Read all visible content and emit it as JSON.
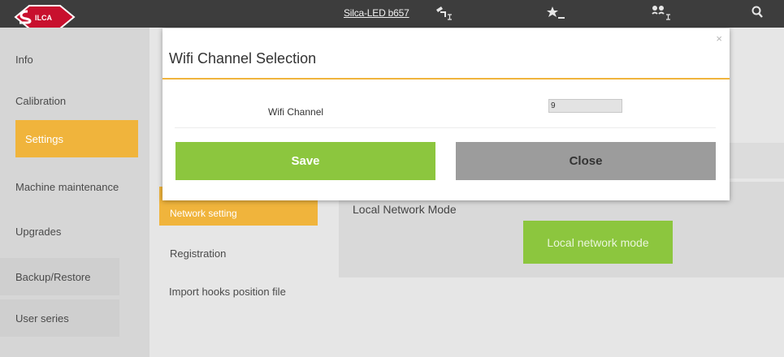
{
  "topbar": {
    "device_name": "Silca-LED b657",
    "icons": [
      "machine-icon",
      "star-icon",
      "users-icon",
      "search-icon"
    ]
  },
  "sidebar": {
    "items": [
      {
        "label": "Info"
      },
      {
        "label": "Calibration"
      },
      {
        "label": "Settings",
        "active": true
      },
      {
        "label": "Machine maintenance"
      },
      {
        "label": "Upgrades"
      },
      {
        "label": "Backup/Restore"
      },
      {
        "label": "User  series"
      }
    ]
  },
  "subnav": {
    "items": [
      {
        "label": "Network setting",
        "active": true
      },
      {
        "label": "Registration"
      },
      {
        "label": "Import hooks position file"
      }
    ]
  },
  "panel": {
    "title": "Local Network Mode",
    "button_label": "Local network mode"
  },
  "modal": {
    "title": "Wifi Channel Selection",
    "close_glyph": "×",
    "field_label": "Wifi Channel",
    "field_value": "9",
    "save_label": "Save",
    "close_label": "Close"
  },
  "colors": {
    "accent": "#f0b43c",
    "save": "#8cc63e",
    "close": "#9c9c9c",
    "topbar": "#3d3d3d"
  }
}
